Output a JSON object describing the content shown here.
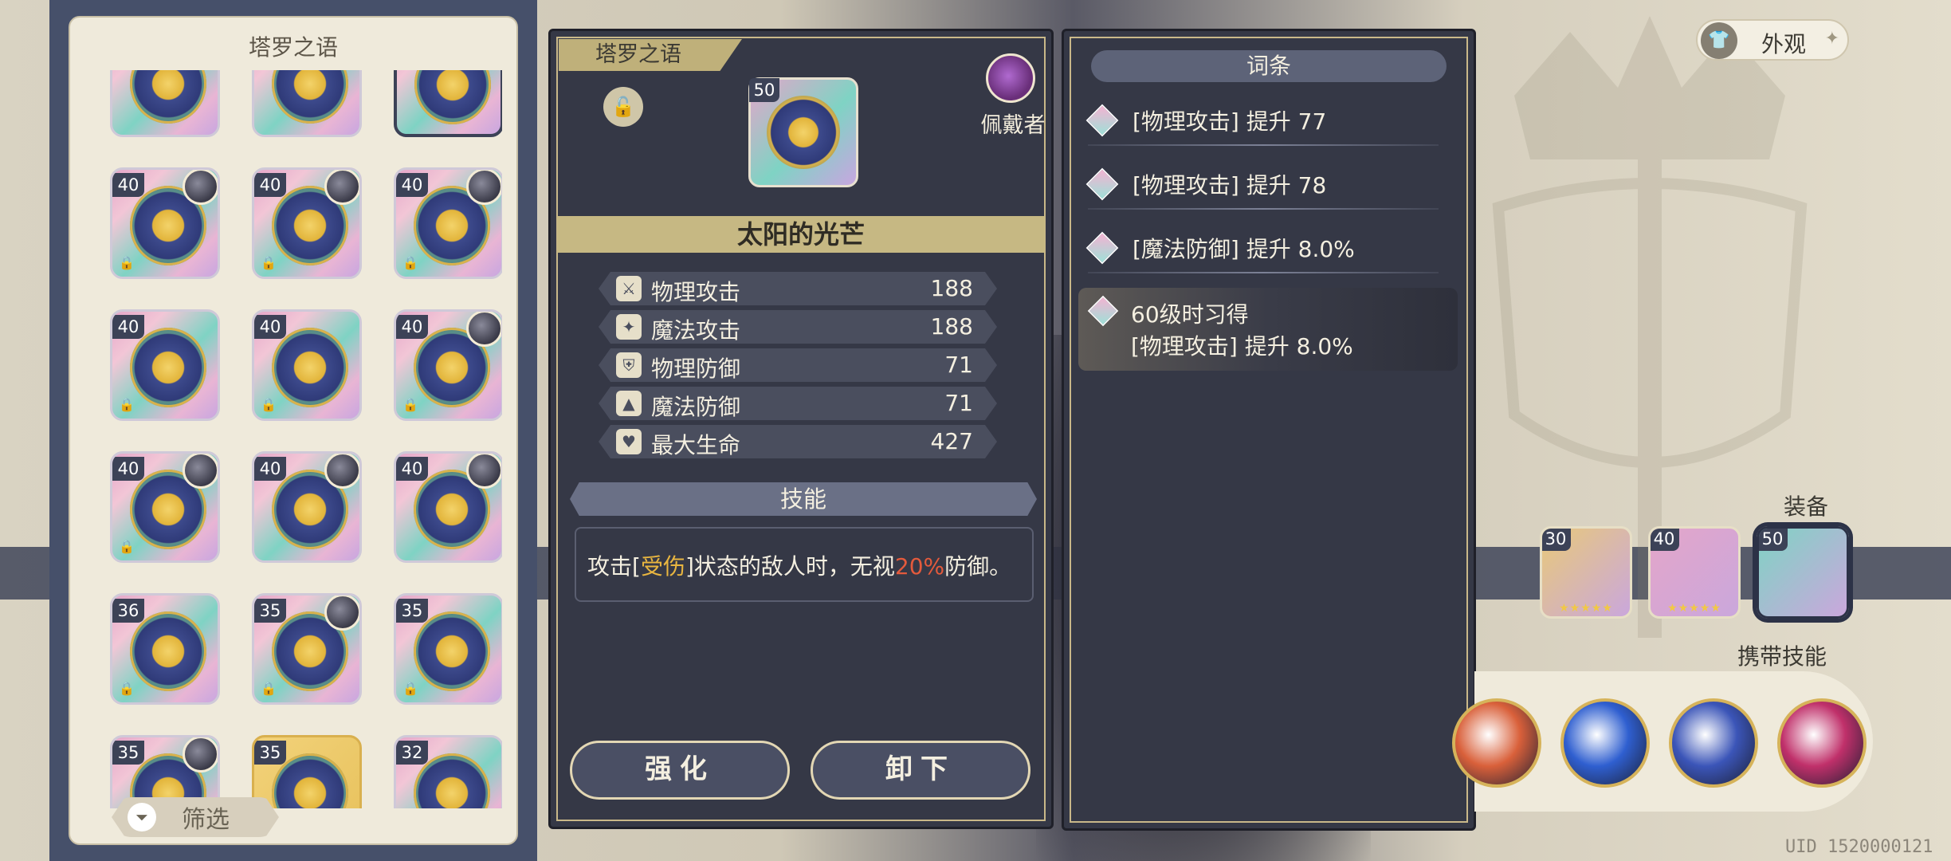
{
  "inventory": {
    "title": "塔罗之语",
    "filter_label": "筛选",
    "cards": [
      {
        "level": "",
        "locked": false,
        "wearer": false
      },
      {
        "level": "",
        "locked": false,
        "wearer": false
      },
      {
        "level": "",
        "locked": false,
        "wearer": false,
        "selected": true
      },
      {
        "level": "40",
        "locked": true,
        "wearer": true
      },
      {
        "level": "40",
        "locked": true,
        "wearer": true
      },
      {
        "level": "40",
        "locked": true,
        "wearer": true
      },
      {
        "level": "40",
        "locked": true,
        "wearer": false
      },
      {
        "level": "40",
        "locked": true,
        "wearer": false
      },
      {
        "level": "40",
        "locked": true,
        "wearer": true
      },
      {
        "level": "40",
        "locked": true,
        "wearer": true
      },
      {
        "level": "40",
        "locked": false,
        "wearer": true
      },
      {
        "level": "40",
        "locked": false,
        "wearer": true
      },
      {
        "level": "36",
        "locked": true,
        "wearer": false
      },
      {
        "level": "35",
        "locked": true,
        "wearer": true
      },
      {
        "level": "35",
        "locked": true,
        "wearer": false
      },
      {
        "level": "35",
        "locked": false,
        "wearer": true
      },
      {
        "level": "35",
        "locked": false,
        "wearer": false,
        "gold": true
      },
      {
        "level": "32",
        "locked": false,
        "wearer": false
      }
    ]
  },
  "detail": {
    "tag": "塔罗之语",
    "item_level": "50",
    "wearer_label": "佩戴者",
    "item_name": "太阳的光芒",
    "stats": [
      {
        "icon": "sword-icon",
        "glyph": "⚔",
        "name": "物理攻击",
        "value": "188"
      },
      {
        "icon": "wand-icon",
        "glyph": "✦",
        "name": "魔法攻击",
        "value": "188"
      },
      {
        "icon": "shield-icon",
        "glyph": "⛨",
        "name": "物理防御",
        "value": "71"
      },
      {
        "icon": "hat-icon",
        "glyph": "▲",
        "name": "魔法防御",
        "value": "71"
      },
      {
        "icon": "heart-icon",
        "glyph": "♥",
        "name": "最大生命",
        "value": "427"
      }
    ],
    "skill_header": "技能",
    "skill_text": {
      "part1": "攻击[",
      "keyword": "受伤",
      "part2": "]状态的敌人时，无视",
      "percent": "20%",
      "part3": "防御。"
    },
    "enhance_label": "强化",
    "unequip_label": "卸下"
  },
  "affixes": {
    "header": "词条",
    "items": [
      "[物理攻击] 提升 77",
      "[物理攻击] 提升 78",
      "[魔法防御] 提升 8.0%"
    ],
    "unlock_title": "60级时习得",
    "unlock_text": "[物理攻击] 提升 8.0%"
  },
  "hud": {
    "appearance_label": "外观",
    "equipment_label": "装备",
    "carried_skills_label": "携带技能",
    "equip_slots": [
      {
        "level": "30",
        "stars": "★★★★★",
        "color": "#e8c97a"
      },
      {
        "level": "40",
        "stars": "★★★★★",
        "color": "#e4a6c9"
      },
      {
        "level": "50",
        "stars": "",
        "color": "#7fd3c4"
      }
    ],
    "skill_colors": [
      "#d9603a",
      "#2f5fd0",
      "#3b55b8",
      "#c0306a"
    ],
    "uid": "UID 1520000121"
  }
}
